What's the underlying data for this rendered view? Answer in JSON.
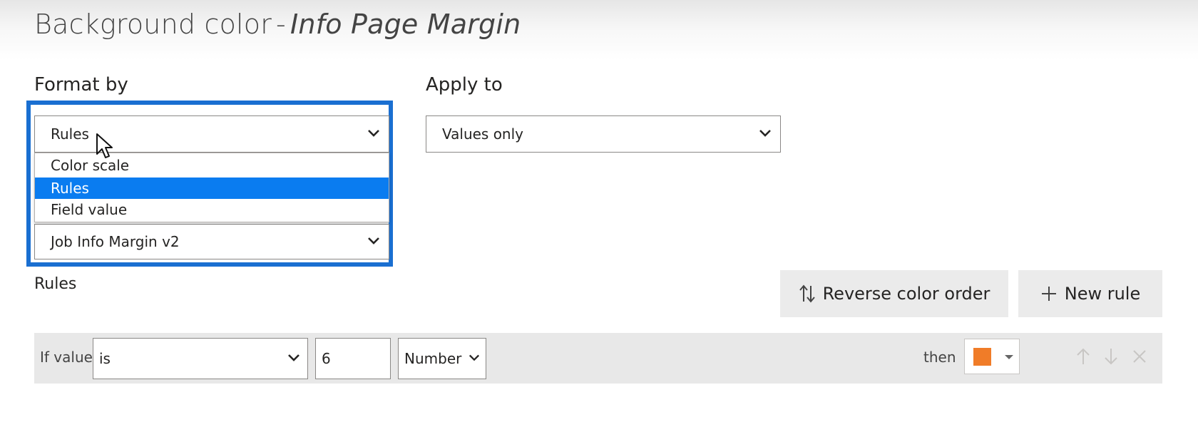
{
  "dialog": {
    "title_main": "Background color",
    "title_separator": "-",
    "title_field": "Info Page Margin"
  },
  "format_by": {
    "label": "Format by",
    "selected": "Rules",
    "options": [
      "Color scale",
      "Rules",
      "Field value"
    ],
    "highlighted_option": "Rules"
  },
  "based_on_field": {
    "value": "Job Info Margin v2"
  },
  "apply_to": {
    "label": "Apply to",
    "selected": "Values only"
  },
  "rules_section": {
    "label": "Rules",
    "reverse_button_label": "Reverse color order",
    "new_rule_button_label": "New rule"
  },
  "rule_row": {
    "if_value_label": "If value",
    "operator": "is",
    "value": "6",
    "value_type": "Number",
    "then_label": "then",
    "color": "#f07c28"
  },
  "colors": {
    "accent_blue": "#1a6fd1",
    "selected_option_bg": "#0a7cf0",
    "button_bg": "#ebebeb",
    "rule_row_bg": "#e8e8e8"
  },
  "icons": {
    "chevron": "chevron-down-icon",
    "cursor": "mouse-pointer-icon",
    "sort": "sort-arrows-icon",
    "add": "plus-icon",
    "up": "arrow-up-icon",
    "down": "arrow-down-icon",
    "delete": "close-icon"
  }
}
